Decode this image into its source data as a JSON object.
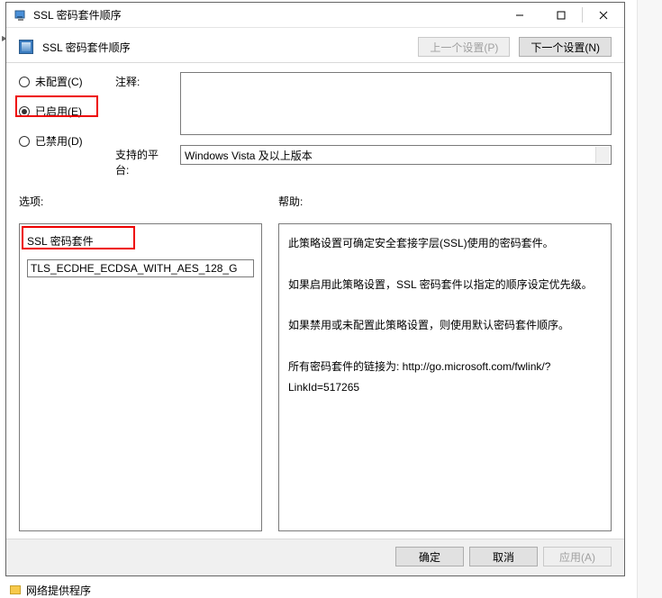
{
  "window": {
    "title": "SSL 密码套件顺序",
    "minimize_tooltip": "最小化",
    "maximize_tooltip": "最大化",
    "close_tooltip": "关闭"
  },
  "header": {
    "title": "SSL 密码套件顺序",
    "prev_setting": "上一个设置(P)",
    "next_setting": "下一个设置(N)"
  },
  "config": {
    "not_configured": "未配置(C)",
    "enabled": "已启用(E)",
    "disabled": "已禁用(D)",
    "selected": "enabled",
    "comment_label": "注释:",
    "comment_value": "",
    "platform_label": "支持的平台:",
    "platform_value": "Windows Vista 及以上版本"
  },
  "sections": {
    "options_label": "选项:",
    "help_label": "帮助:"
  },
  "options": {
    "ssl_suite_label": "SSL 密码套件",
    "cipher_value": "TLS_ECDHE_ECDSA_WITH_AES_128_G"
  },
  "help": {
    "text": "此策略设置可确定安全套接字层(SSL)使用的密码套件。\n\n如果启用此策略设置，SSL 密码套件以指定的顺序设定优先级。\n\n如果禁用或未配置此策略设置，则使用默认密码套件顺序。\n\n所有密码套件的链接为: http://go.microsoft.com/fwlink/?LinkId=517265"
  },
  "footer": {
    "ok": "确定",
    "cancel": "取消",
    "apply": "应用(A)"
  },
  "outer": {
    "bottom_tree_label": "网络提供程序"
  }
}
